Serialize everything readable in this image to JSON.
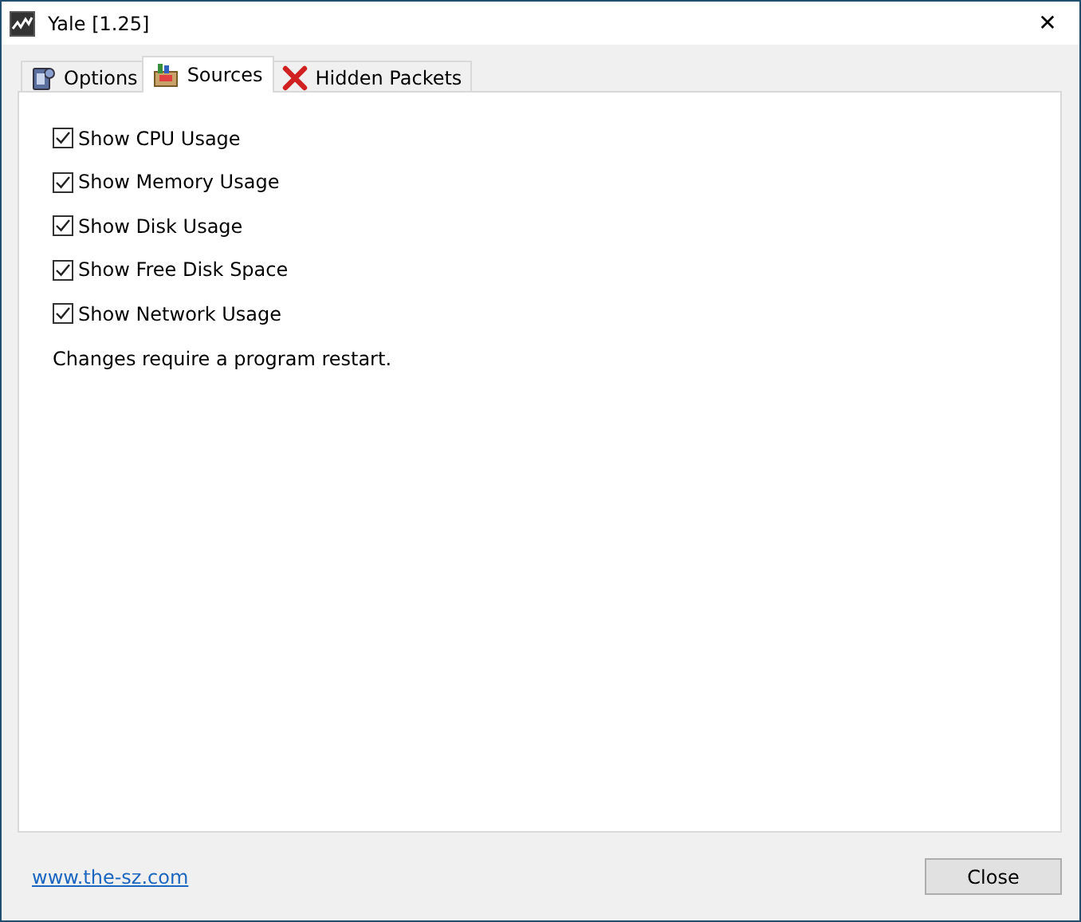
{
  "window": {
    "title": "Yale [1.25]",
    "close": "✕"
  },
  "tabs": [
    {
      "label": "Options",
      "selected": false
    },
    {
      "label": "Sources",
      "selected": true
    },
    {
      "label": "Hidden Packets",
      "selected": false
    }
  ],
  "options": [
    {
      "label": "Show CPU Usage",
      "checked": true
    },
    {
      "label": "Show Memory Usage",
      "checked": true
    },
    {
      "label": "Show Disk Usage",
      "checked": true
    },
    {
      "label": "Show Free Disk Space",
      "checked": true
    },
    {
      "label": "Show Network Usage",
      "checked": true
    }
  ],
  "note": "Changes require a program restart.",
  "footer": {
    "link": "www.the-sz.com",
    "button": "Close"
  }
}
